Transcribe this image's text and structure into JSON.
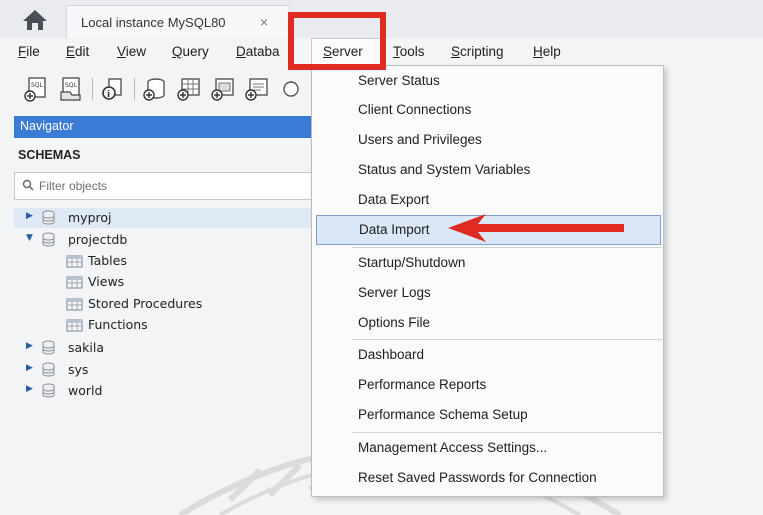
{
  "tabbar": {
    "home_icon": "home-icon",
    "tab_title": "Local instance MySQL80",
    "tab_close": "×"
  },
  "menubar": {
    "items": [
      {
        "label": "File",
        "mnemonic": "F",
        "rest": "ile"
      },
      {
        "label": "Edit",
        "mnemonic": "E",
        "rest": "dit"
      },
      {
        "label": "View",
        "mnemonic": "V",
        "rest": "iew"
      },
      {
        "label": "Query",
        "mnemonic": "Q",
        "rest": "uery"
      },
      {
        "label": "Databa",
        "mnemonic": "D",
        "rest": "ataba"
      },
      {
        "label": "Server",
        "mnemonic": "S",
        "rest": "erver"
      },
      {
        "label": "Tools",
        "mnemonic": "T",
        "rest": "ools"
      },
      {
        "label": "Scripting",
        "mnemonic": "S",
        "rest": "cripting"
      },
      {
        "label": "Help",
        "mnemonic": "H",
        "rest": "elp"
      }
    ]
  },
  "toolbar": {
    "icons": [
      "new-sql-tab-icon",
      "open-sql-script-icon",
      "inspector-icon",
      "create-schema-icon",
      "create-table-icon",
      "create-view-icon",
      "create-procedure-icon"
    ]
  },
  "navigator": {
    "header": "Navigator",
    "schemas_title": "SCHEMAS",
    "filter_placeholder": "Filter objects",
    "tree": [
      {
        "label": "myproj",
        "kind": "schema",
        "expanded": false,
        "selected": true
      },
      {
        "label": "projectdb",
        "kind": "schema",
        "expanded": true,
        "selected": false
      },
      {
        "label": "Tables",
        "kind": "folder"
      },
      {
        "label": "Views",
        "kind": "folder"
      },
      {
        "label": "Stored Procedures",
        "kind": "folder"
      },
      {
        "label": "Functions",
        "kind": "folder"
      },
      {
        "label": "sakila",
        "kind": "schema",
        "expanded": false
      },
      {
        "label": "sys",
        "kind": "schema",
        "expanded": false
      },
      {
        "label": "world",
        "kind": "schema",
        "expanded": false
      }
    ]
  },
  "server_menu": {
    "items": [
      {
        "label": "Server Status"
      },
      {
        "label": "Client Connections"
      },
      {
        "label": "Users and Privileges"
      },
      {
        "label": "Status and System Variables"
      },
      {
        "label": "Data Export"
      },
      {
        "label": "Data Import",
        "highlighted": true
      },
      {
        "label": "Startup/Shutdown"
      },
      {
        "label": "Server Logs"
      },
      {
        "label": "Options File"
      },
      {
        "label": "Dashboard"
      },
      {
        "label": "Performance Reports"
      },
      {
        "label": "Performance Schema Setup"
      },
      {
        "label": "Management Access Settings..."
      },
      {
        "label": "Reset Saved Passwords for Connection"
      }
    ]
  },
  "annotation": {
    "highlight_color": "#e02a22",
    "arrow_color": "#e02a22"
  },
  "colors": {
    "navigator_header": "#3a7bd5",
    "menu_hover": "#dae7f7"
  }
}
